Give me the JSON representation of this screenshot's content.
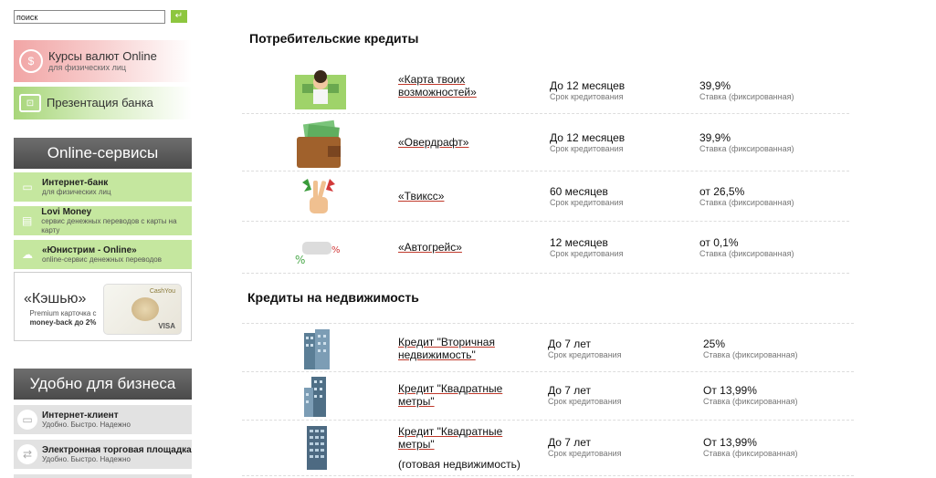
{
  "search": {
    "placeholder": "поиск",
    "value": "поиск",
    "button_icon": "enter-arrow-icon"
  },
  "promos": [
    {
      "title": "Курсы валют Online",
      "subtitle": "для физических лиц",
      "icon": "currency-coin-icon"
    },
    {
      "title": "Презентация банка",
      "subtitle": "",
      "icon": "presentation-board-icon"
    }
  ],
  "online_services": {
    "header": "Online-сервисы",
    "items": [
      {
        "title": "Интернет-банк",
        "subtitle": "для физических лиц",
        "icon": "laptop-icon"
      },
      {
        "title": "Lovi Money",
        "subtitle": "сервис денежных переводов с карты на карту",
        "icon": "card-transfer-icon"
      },
      {
        "title": "«Юнистрим - Online»",
        "subtitle": "online-сервис денежных переводов",
        "icon": "cloud-transfer-icon"
      }
    ]
  },
  "cashback_banner": {
    "title": "«Кэшью»",
    "line1": "Premium карточка с",
    "line2": "money-back до 2%",
    "card_brand": "CashYou",
    "card_network": "VISA"
  },
  "business": {
    "header": "Удобно для бизнеса",
    "items": [
      {
        "title": "Интернет-клиент",
        "subtitle": "Удобно. Быстро. Надежно",
        "icon": "monitor-icon"
      },
      {
        "title": "Электронная торговая площадка",
        "subtitle": "Удобно. Быстро. Надежно",
        "icon": "coin-exchange-icon"
      }
    ]
  },
  "consumer": {
    "heading": "Потребительские кредиты",
    "rows": [
      {
        "name": "«Карта твоих возможностей»",
        "term": "До 12 месяцев",
        "term_label": "Срок кредитования",
        "rate": "39,9%",
        "rate_label": "Ставка (фиксированная)",
        "icon": "happy-man-icon"
      },
      {
        "name": "«Овердрафт»",
        "term": "До 12 месяцев",
        "term_label": "Срок кредитования",
        "rate": "39,9%",
        "rate_label": "Ставка (фиксированная)",
        "icon": "wallet-icon"
      },
      {
        "name": "«Твикcс»",
        "term": "60 месяцев",
        "term_label": "Срок кредитования",
        "rate": "от 26,5%",
        "rate_label": "Ставка (фиксированная)",
        "icon": "victory-hand-icon"
      },
      {
        "name": "«Автогрейс»",
        "term": "12 месяцев",
        "term_label": "Срок кредитования",
        "rate": "от 0,1%",
        "rate_label": "Ставка (фиксированная)",
        "icon": "percent-car-icon"
      }
    ]
  },
  "realty": {
    "heading": "Кредиты на недвижимость",
    "rows": [
      {
        "name_line1": "Кредит \"Вторичная",
        "name_line2": "недвижимость\"",
        "note": "",
        "term": "До 7 лет",
        "term_label": "Срок кредитования",
        "rate": "25%",
        "rate_label": "Ставка (фиксированная)",
        "icon": "building-icon"
      },
      {
        "name_line1": "Кредит \"Квадратные",
        "name_line2": "метры\"",
        "note": "",
        "term": "До 7 лет",
        "term_label": "Срок кредитования",
        "rate": "От 13,99%",
        "rate_label": "Ставка (фиксированная)",
        "icon": "tower-icon"
      },
      {
        "name_line1": "Кредит \"Квадратные",
        "name_line2": "метры\"",
        "note": "(готовая недвижимость)",
        "term": "До 7 лет",
        "term_label": "Срок кредитования",
        "rate": "От 13,99%",
        "rate_label": "Ставка (фиксированная)",
        "icon": "skyscraper-icon"
      }
    ]
  },
  "colors": {
    "accent_green": "#8dc63f",
    "promo_red": "#f1a5a5",
    "service_green": "#c5e79f",
    "header_gray": "#555555",
    "link_underline": "#c0392b"
  }
}
